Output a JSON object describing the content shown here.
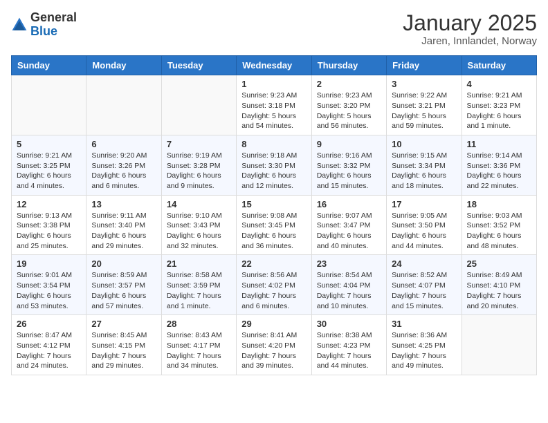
{
  "header": {
    "logo_general": "General",
    "logo_blue": "Blue",
    "title": "January 2025",
    "subtitle": "Jaren, Innlandet, Norway"
  },
  "days_of_week": [
    "Sunday",
    "Monday",
    "Tuesday",
    "Wednesday",
    "Thursday",
    "Friday",
    "Saturday"
  ],
  "weeks": [
    [
      {
        "day": "",
        "info": ""
      },
      {
        "day": "",
        "info": ""
      },
      {
        "day": "",
        "info": ""
      },
      {
        "day": "1",
        "info": "Sunrise: 9:23 AM\nSunset: 3:18 PM\nDaylight: 5 hours and 54 minutes."
      },
      {
        "day": "2",
        "info": "Sunrise: 9:23 AM\nSunset: 3:20 PM\nDaylight: 5 hours and 56 minutes."
      },
      {
        "day": "3",
        "info": "Sunrise: 9:22 AM\nSunset: 3:21 PM\nDaylight: 5 hours and 59 minutes."
      },
      {
        "day": "4",
        "info": "Sunrise: 9:21 AM\nSunset: 3:23 PM\nDaylight: 6 hours and 1 minute."
      }
    ],
    [
      {
        "day": "5",
        "info": "Sunrise: 9:21 AM\nSunset: 3:25 PM\nDaylight: 6 hours and 4 minutes."
      },
      {
        "day": "6",
        "info": "Sunrise: 9:20 AM\nSunset: 3:26 PM\nDaylight: 6 hours and 6 minutes."
      },
      {
        "day": "7",
        "info": "Sunrise: 9:19 AM\nSunset: 3:28 PM\nDaylight: 6 hours and 9 minutes."
      },
      {
        "day": "8",
        "info": "Sunrise: 9:18 AM\nSunset: 3:30 PM\nDaylight: 6 hours and 12 minutes."
      },
      {
        "day": "9",
        "info": "Sunrise: 9:16 AM\nSunset: 3:32 PM\nDaylight: 6 hours and 15 minutes."
      },
      {
        "day": "10",
        "info": "Sunrise: 9:15 AM\nSunset: 3:34 PM\nDaylight: 6 hours and 18 minutes."
      },
      {
        "day": "11",
        "info": "Sunrise: 9:14 AM\nSunset: 3:36 PM\nDaylight: 6 hours and 22 minutes."
      }
    ],
    [
      {
        "day": "12",
        "info": "Sunrise: 9:13 AM\nSunset: 3:38 PM\nDaylight: 6 hours and 25 minutes."
      },
      {
        "day": "13",
        "info": "Sunrise: 9:11 AM\nSunset: 3:40 PM\nDaylight: 6 hours and 29 minutes."
      },
      {
        "day": "14",
        "info": "Sunrise: 9:10 AM\nSunset: 3:43 PM\nDaylight: 6 hours and 32 minutes."
      },
      {
        "day": "15",
        "info": "Sunrise: 9:08 AM\nSunset: 3:45 PM\nDaylight: 6 hours and 36 minutes."
      },
      {
        "day": "16",
        "info": "Sunrise: 9:07 AM\nSunset: 3:47 PM\nDaylight: 6 hours and 40 minutes."
      },
      {
        "day": "17",
        "info": "Sunrise: 9:05 AM\nSunset: 3:50 PM\nDaylight: 6 hours and 44 minutes."
      },
      {
        "day": "18",
        "info": "Sunrise: 9:03 AM\nSunset: 3:52 PM\nDaylight: 6 hours and 48 minutes."
      }
    ],
    [
      {
        "day": "19",
        "info": "Sunrise: 9:01 AM\nSunset: 3:54 PM\nDaylight: 6 hours and 53 minutes."
      },
      {
        "day": "20",
        "info": "Sunrise: 8:59 AM\nSunset: 3:57 PM\nDaylight: 6 hours and 57 minutes."
      },
      {
        "day": "21",
        "info": "Sunrise: 8:58 AM\nSunset: 3:59 PM\nDaylight: 7 hours and 1 minute."
      },
      {
        "day": "22",
        "info": "Sunrise: 8:56 AM\nSunset: 4:02 PM\nDaylight: 7 hours and 6 minutes."
      },
      {
        "day": "23",
        "info": "Sunrise: 8:54 AM\nSunset: 4:04 PM\nDaylight: 7 hours and 10 minutes."
      },
      {
        "day": "24",
        "info": "Sunrise: 8:52 AM\nSunset: 4:07 PM\nDaylight: 7 hours and 15 minutes."
      },
      {
        "day": "25",
        "info": "Sunrise: 8:49 AM\nSunset: 4:10 PM\nDaylight: 7 hours and 20 minutes."
      }
    ],
    [
      {
        "day": "26",
        "info": "Sunrise: 8:47 AM\nSunset: 4:12 PM\nDaylight: 7 hours and 24 minutes."
      },
      {
        "day": "27",
        "info": "Sunrise: 8:45 AM\nSunset: 4:15 PM\nDaylight: 7 hours and 29 minutes."
      },
      {
        "day": "28",
        "info": "Sunrise: 8:43 AM\nSunset: 4:17 PM\nDaylight: 7 hours and 34 minutes."
      },
      {
        "day": "29",
        "info": "Sunrise: 8:41 AM\nSunset: 4:20 PM\nDaylight: 7 hours and 39 minutes."
      },
      {
        "day": "30",
        "info": "Sunrise: 8:38 AM\nSunset: 4:23 PM\nDaylight: 7 hours and 44 minutes."
      },
      {
        "day": "31",
        "info": "Sunrise: 8:36 AM\nSunset: 4:25 PM\nDaylight: 7 hours and 49 minutes."
      },
      {
        "day": "",
        "info": ""
      }
    ]
  ]
}
